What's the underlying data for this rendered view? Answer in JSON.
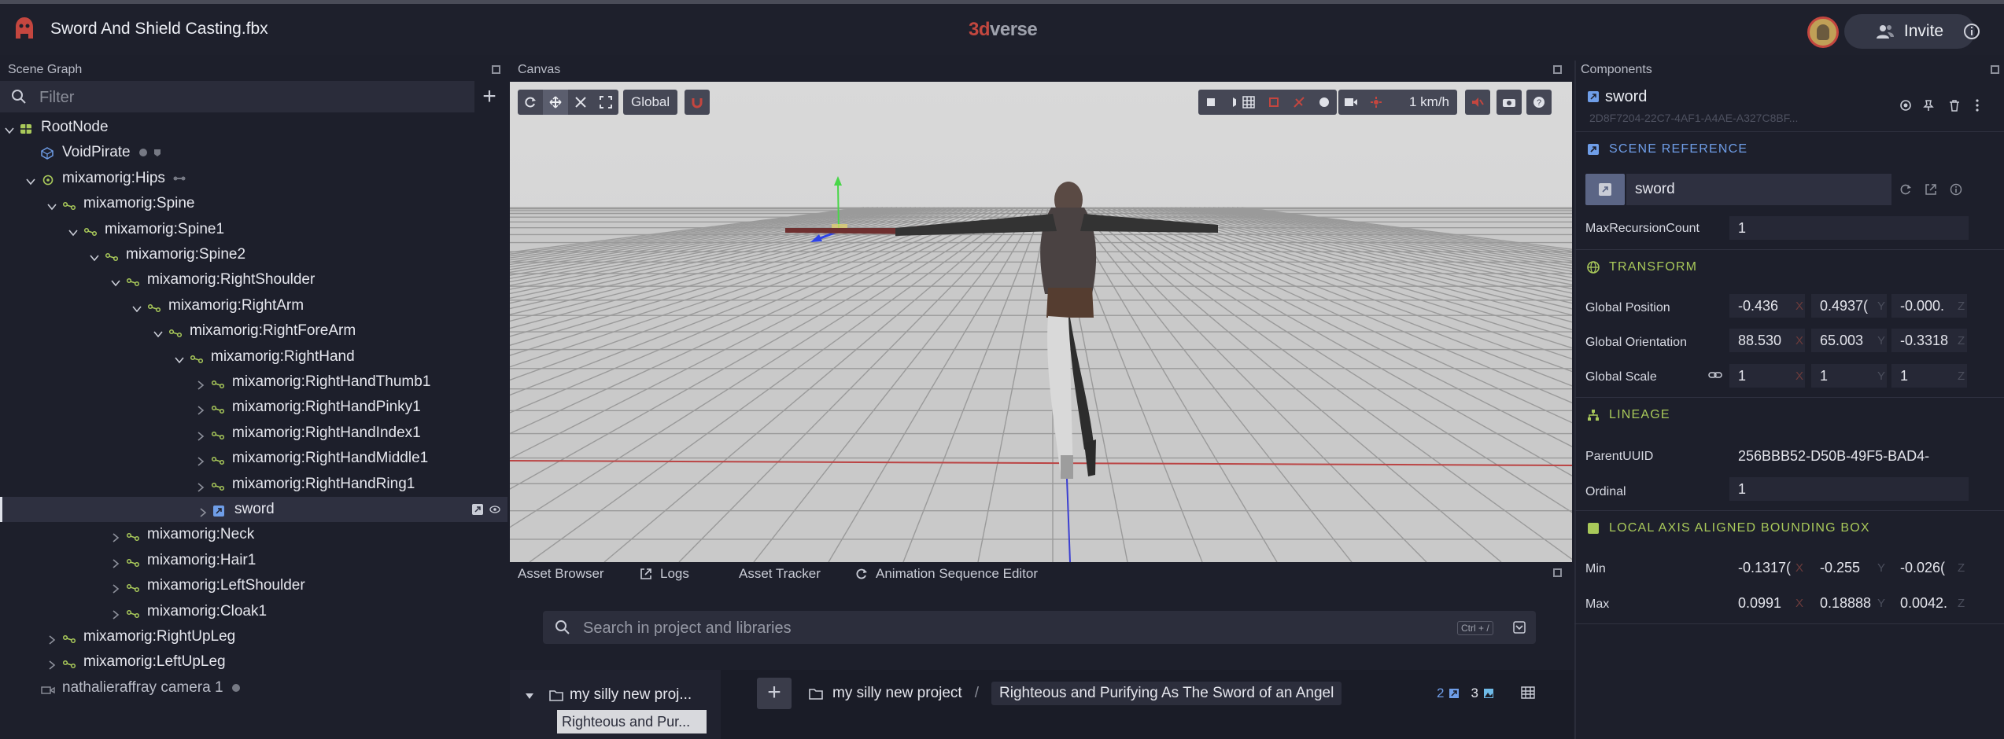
{
  "app": {
    "file_title": "Sword And Shield Casting.fbx",
    "brand_prefix": "3d",
    "brand_suffix": "verse",
    "invite_label": "Invite",
    "accent_color": "#c4463f"
  },
  "scene_graph": {
    "title": "Scene Graph",
    "filter_placeholder": "Filter",
    "nodes": [
      {
        "label": "RootNode"
      },
      {
        "label": "VoidPirate"
      },
      {
        "label": "mixamorig:Hips"
      },
      {
        "label": "mixamorig:Spine"
      },
      {
        "label": "mixamorig:Spine1"
      },
      {
        "label": "mixamorig:Spine2"
      },
      {
        "label": "mixamorig:RightShoulder"
      },
      {
        "label": "mixamorig:RightArm"
      },
      {
        "label": "mixamorig:RightForeArm"
      },
      {
        "label": "mixamorig:RightHand"
      },
      {
        "label": "mixamorig:RightHandThumb1"
      },
      {
        "label": "mixamorig:RightHandPinky1"
      },
      {
        "label": "mixamorig:RightHandIndex1"
      },
      {
        "label": "mixamorig:RightHandMiddle1"
      },
      {
        "label": "mixamorig:RightHandRing1"
      },
      {
        "label": "sword",
        "selected": true
      },
      {
        "label": "mixamorig:Neck"
      },
      {
        "label": "mixamorig:Hair1"
      },
      {
        "label": "mixamorig:LeftShoulder"
      },
      {
        "label": "mixamorig:Cloak1"
      },
      {
        "label": "mixamorig:RightUpLeg"
      },
      {
        "label": "mixamorig:LeftUpLeg"
      },
      {
        "label": "nathalieraffray camera 1"
      }
    ]
  },
  "canvas": {
    "title": "Canvas",
    "space_mode": "Global",
    "speed": "1 km/h"
  },
  "bottom": {
    "tabs": [
      "Asset Browser",
      "Logs",
      "Asset Tracker",
      "Animation Sequence Editor"
    ],
    "search_placeholder": "Search in project and libraries",
    "shortcut": "Ctrl + /",
    "tree_project": "my silly new proj...",
    "tree_child": "Righteous and Pur...",
    "crumb_project": "my silly new project",
    "crumb_separator": "/",
    "crumb_folder": "Righteous and Purifying As The Sword of an Angel",
    "count_scenes": "2",
    "count_textures": "3"
  },
  "components": {
    "title": "Components",
    "entity_name": "sword",
    "entity_uuid": "2D8F7204-22C7-4AF1-A4AE-A327C8BF...",
    "scene_reference": {
      "header": "SCENE REFERENCE",
      "value": "sword",
      "max_recursion_label": "MaxRecursionCount",
      "max_recursion_value": "1"
    },
    "transform": {
      "header": "TRANSFORM",
      "position_label": "Global Position",
      "position": [
        "-0.436",
        "0.4937(",
        "-0.000."
      ],
      "orientation_label": "Global Orientation",
      "orientation": [
        "88.530",
        "65.003",
        "-0.3318"
      ],
      "scale_label": "Global Scale",
      "scale": [
        "1",
        "1",
        "1"
      ]
    },
    "lineage": {
      "header": "LINEAGE",
      "parent_label": "ParentUUID",
      "parent_value": "256BBB52-D50B-49F5-BAD4-",
      "ordinal_label": "Ordinal",
      "ordinal_value": "1"
    },
    "bbox": {
      "header": "LOCAL AXIS ALIGNED BOUNDING BOX",
      "min_label": "Min",
      "min": [
        "-0.1317(",
        "-0.255",
        "-0.026("
      ],
      "max_label": "Max",
      "max": [
        "0.0991",
        "0.18888",
        "0.0042."
      ]
    },
    "axes": [
      "X",
      "Y",
      "Z"
    ],
    "colors": {
      "section_blue": "#6f9ee8",
      "section_green": "#a9c95a"
    }
  }
}
